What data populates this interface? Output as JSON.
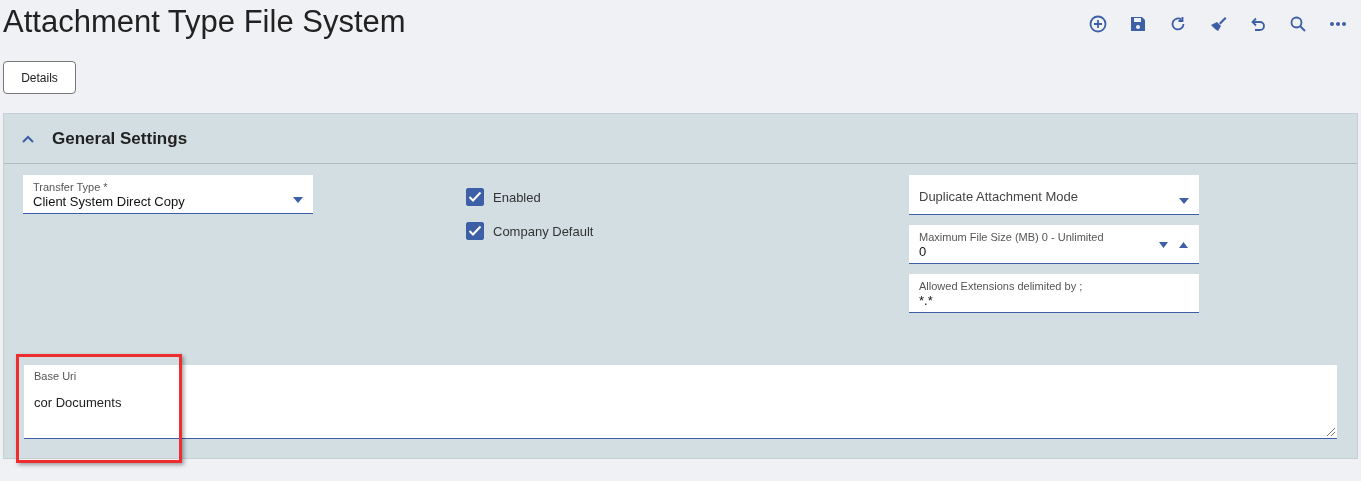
{
  "page": {
    "title": "Attachment Type File System"
  },
  "toolbar": [
    {
      "kind": "add"
    },
    {
      "kind": "save"
    },
    {
      "kind": "refresh"
    },
    {
      "kind": "clear"
    },
    {
      "kind": "undo"
    },
    {
      "kind": "search"
    },
    {
      "kind": "more"
    }
  ],
  "tabs": [
    {
      "label": "Details",
      "selected": true
    }
  ],
  "section": {
    "title": "General Settings",
    "expanded": true,
    "transfer_type": {
      "label": "Transfer Type *",
      "value": "Client System Direct Copy"
    },
    "checkboxes": [
      {
        "label": "Enabled",
        "checked": true
      },
      {
        "label": "Company Default",
        "checked": true
      }
    ],
    "duplicate_mode": {
      "placeholder": "Duplicate Attachment Mode"
    },
    "max_file_size": {
      "label": "Maximum File Size (MB) 0 - Unlimited",
      "value": "0"
    },
    "allowed_extensions": {
      "label": "Allowed Extensions delimited by ;",
      "value": "*.*"
    },
    "base_uri": {
      "label": "Base Uri",
      "value": "cor Documents",
      "highlighted": true
    }
  }
}
